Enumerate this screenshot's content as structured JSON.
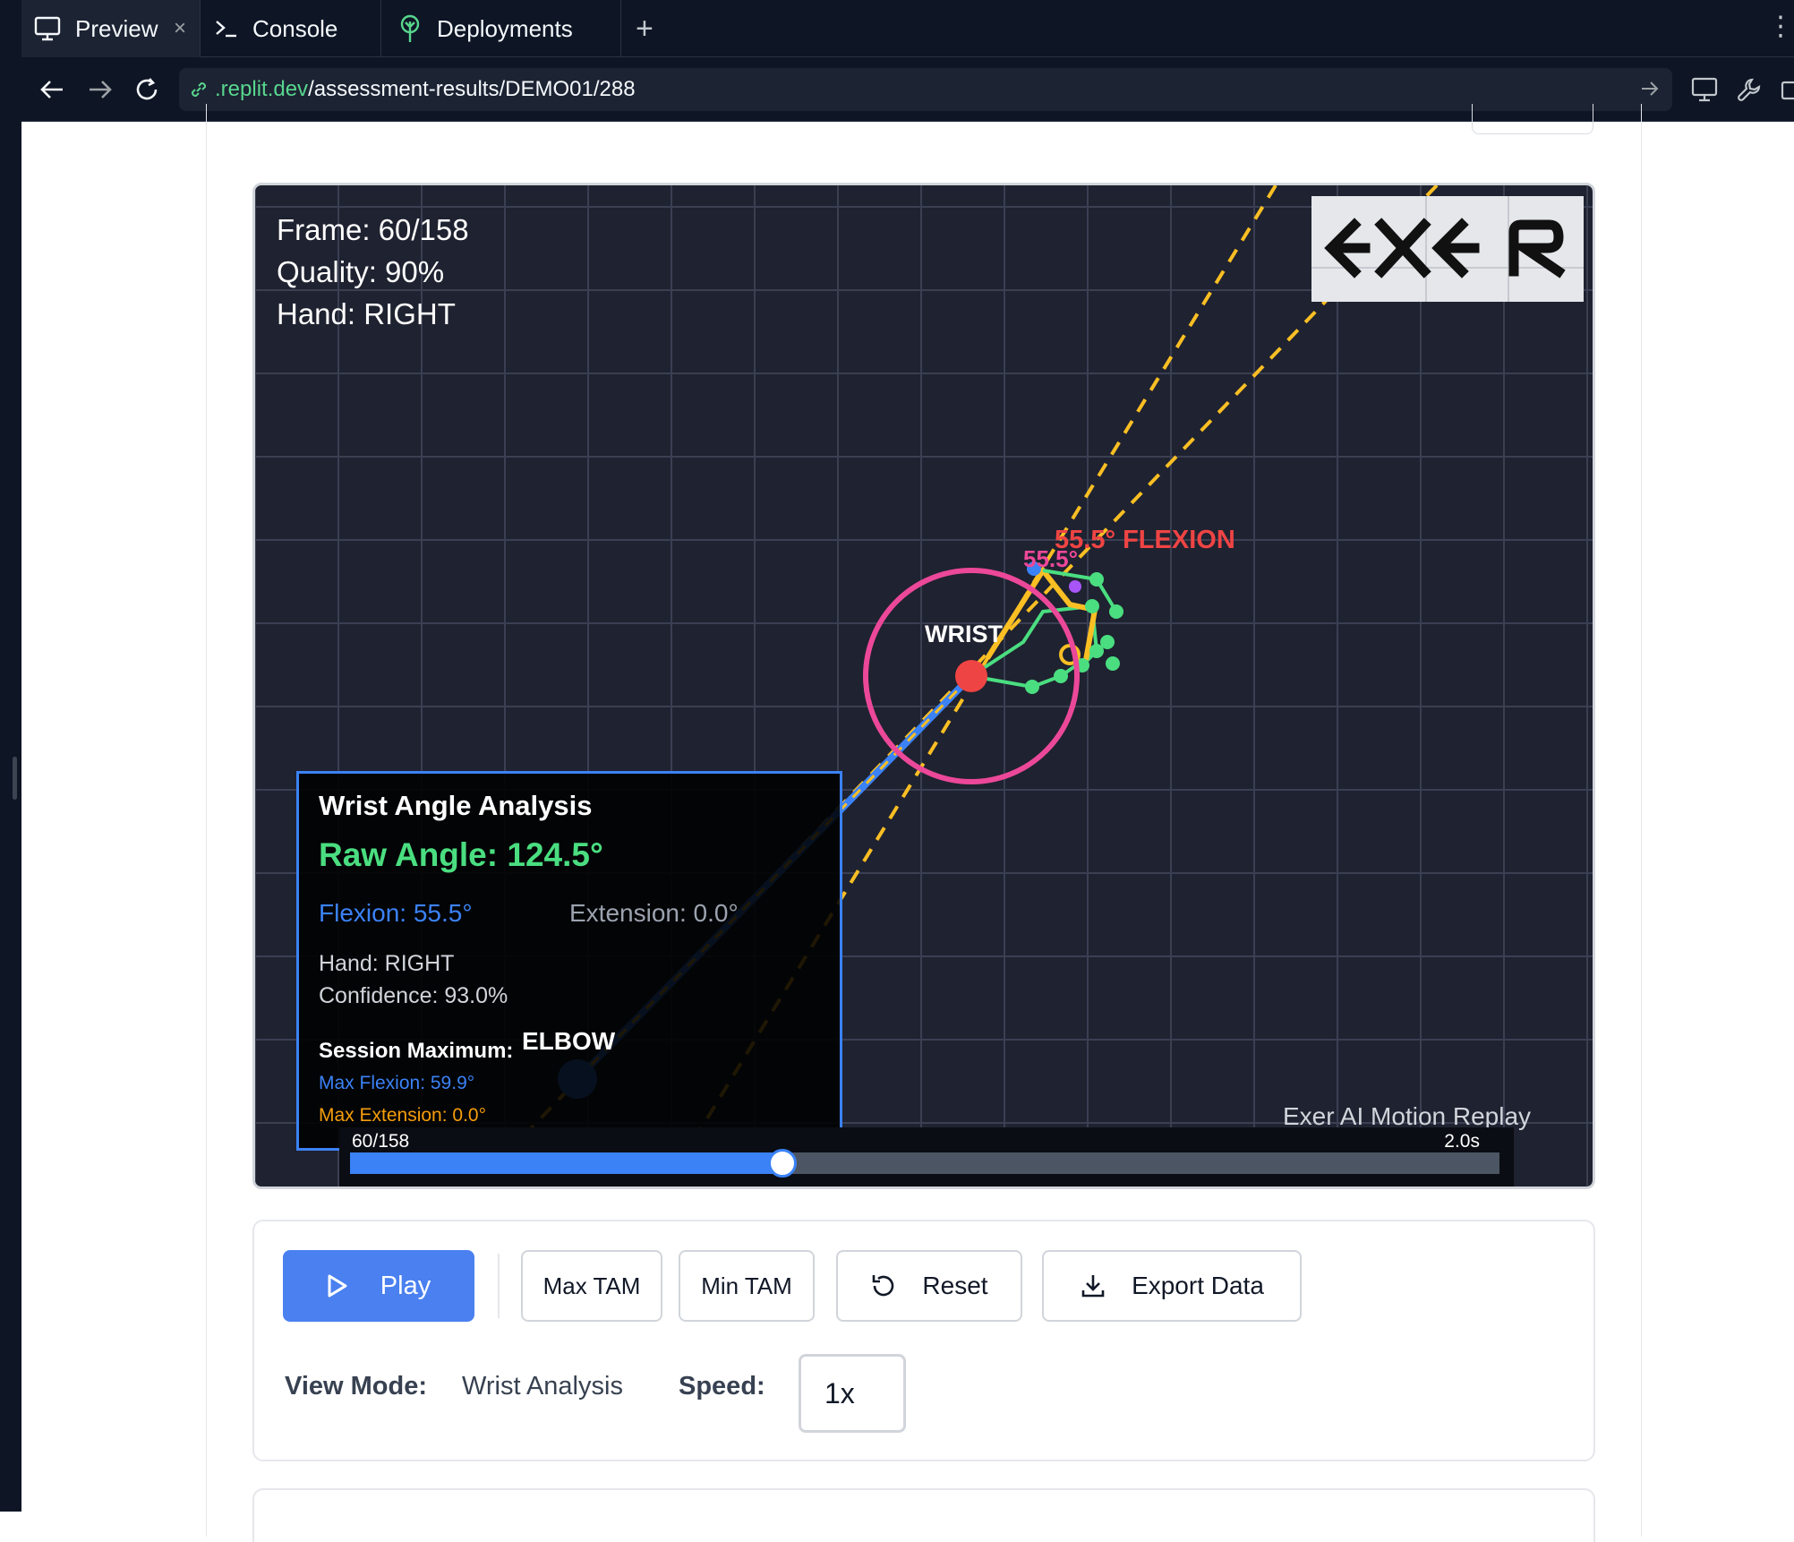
{
  "tabs": {
    "preview": "Preview",
    "console": "Console",
    "deployments": "Deployments",
    "close_glyph": "×",
    "add_glyph": "+"
  },
  "address": {
    "host": ".replit.dev",
    "path": "/assessment-results/DEMO01/288"
  },
  "viewer": {
    "frame": "Frame: 60/158",
    "quality": "Quality: 90%",
    "hand": "Hand: RIGHT",
    "wrist_label": "WRIST",
    "elbow_label": "ELBOW",
    "flexion_label": "55.5° FLEXION",
    "flexion_label_small": "55.5°",
    "caption": "Exer AI Motion Replay",
    "logo": "EXER",
    "progress": 0.376,
    "scrub_frame": "60/158",
    "scrub_time": "2.0s"
  },
  "analysis": {
    "title": "Wrist Angle Analysis",
    "raw_angle": "Raw Angle: 124.5°",
    "flexion": "Flexion: 55.5°",
    "extension": "Extension: 0.0°",
    "hand": "Hand: RIGHT",
    "confidence": "Confidence: 93.0%",
    "session_max": "Session Maximum:",
    "max_flexion": "Max Flexion: 59.9°",
    "max_extension": "Max Extension: 0.0°"
  },
  "controls": {
    "play": "Play",
    "max_tam": "Max TAM",
    "min_tam": "Min TAM",
    "reset": "Reset",
    "export": "Export Data",
    "view_mode_label": "View Mode:",
    "view_mode_value": "Wrist Analysis",
    "speed_label": "Speed:",
    "speed_value": "1x"
  },
  "colors": {
    "accent": "#4a80f0",
    "flexion": "#3b82f6",
    "raw_angle": "#4ade80",
    "extension": "#f59e0b",
    "wrist_ring": "#ec4899",
    "wrist_point": "#ef4444"
  }
}
